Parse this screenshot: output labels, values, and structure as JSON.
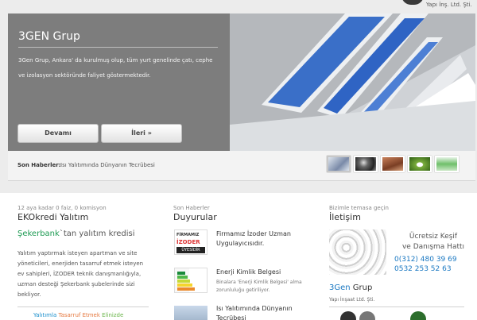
{
  "header": {
    "company_name": "Yapı İnş. Ltd. Şti."
  },
  "slider": {
    "title": "3GEN Grup",
    "text": "3Gen Grup, Ankara' da kurulmuş olup, tüm yurt genelinde çatı, cephe ve  izolasyon sektöründe faliyet göstermektedir.",
    "btn_more": "Devamı",
    "btn_next": "İleri »"
  },
  "newsbar": {
    "label": "Son Haberler:",
    "text": "Isı Yalıtımında Dünyanın Tecrübesi"
  },
  "col1": {
    "kicker": "12 aya kadar 0 faiz, 0 komisyon",
    "heading": "EKOkredi Yalıtım",
    "bank": "Şekerbank",
    "bank_suffix": "`tan yalıtım kredisi",
    "body": "Yalıtım yaptırmak isteyen apartman ve site yöneticileri, enerjiden tasarruf etmek isteyen ev sahipleri, İZODER teknik danışmanlığıyla, uzman desteği Şekerbank şubelerinde sizi bekliyor.",
    "bottom_1": "Yalıtımla",
    "bottom_2": "Tasarruf Etmek",
    "bottom_3": "Elinizde"
  },
  "col2": {
    "kicker": "Son Haberler",
    "heading": "Duyurular",
    "items": [
      {
        "title": "Firmamız İzoder Uzman Uygulayıcısıdır.",
        "sub": ""
      },
      {
        "title": "Enerji Kimlik Belgesi",
        "sub": "Binalara 'Enerji Kimlik Belgesi' alma zorunluluğu getiriliyor."
      },
      {
        "title": "Isı Yalıtımında Dünyanın Tecrübesi",
        "sub": ""
      }
    ],
    "izoder_logo": {
      "l1": "FİRMAMIZ",
      "l2": "İZODER",
      "l3": "ÜYESİDİR"
    }
  },
  "col3": {
    "kicker": "Bizimle temasa geçin",
    "heading": "İletişim",
    "line1": "Ücretsiz Keşif",
    "line2": "ve Danışma Hattı",
    "phone1": "0(312) 480 39 69",
    "phone2": "0532 253 52 63",
    "brand_a": "3Gen",
    "brand_b": "Grup",
    "brand_sub": "Yapı İnşaat Ltd. Şti."
  }
}
